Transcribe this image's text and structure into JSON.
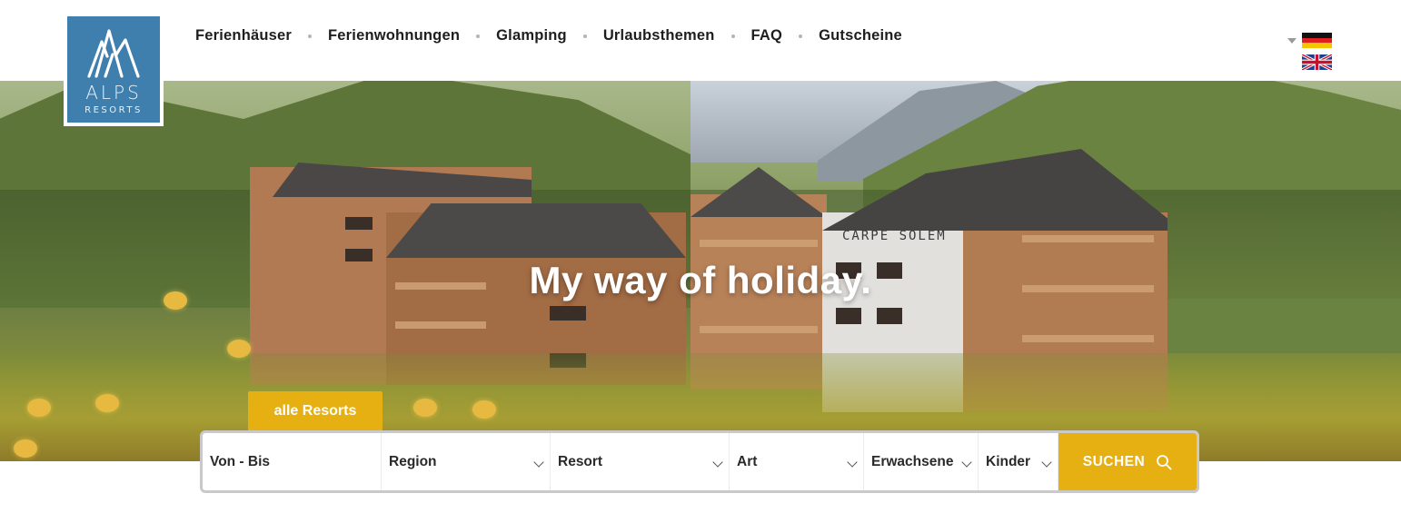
{
  "brand": {
    "name": "ALPS",
    "sub": "RESORTS",
    "accent": "#3f7fae"
  },
  "nav": {
    "items": [
      {
        "label": "Ferienhäuser"
      },
      {
        "label": "Ferienwohnungen"
      },
      {
        "label": "Glamping"
      },
      {
        "label": "Urlaubsthemen"
      },
      {
        "label": "FAQ"
      },
      {
        "label": "Gutscheine"
      }
    ]
  },
  "languages": {
    "active": "german-flag-icon",
    "other": "uk-flag-icon"
  },
  "hero": {
    "title": "My way of holiday.",
    "building_sign": "CARPE SOLEM"
  },
  "search": {
    "tab_label": "alle Resorts",
    "fields": {
      "dates": "Von - Bis",
      "region": "Region",
      "resort": "Resort",
      "type": "Art",
      "adults": "Erwachsene",
      "children": "Kinder"
    },
    "button_label": "SUCHEN",
    "button_color": "#e6b013"
  }
}
